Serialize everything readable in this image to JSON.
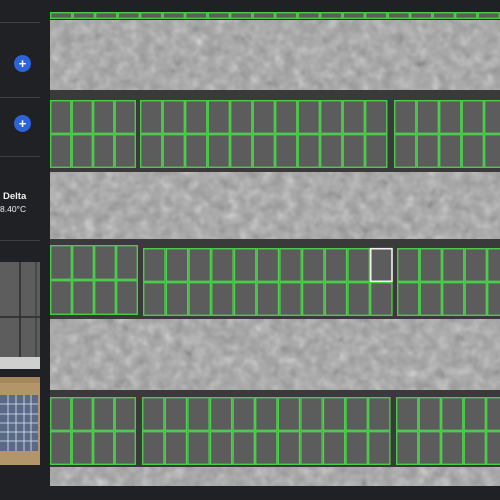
{
  "sidebar": {
    "delta": {
      "label": "Delta",
      "value": "8.40°C"
    },
    "thumbnails": {
      "thermal": "thermal-thumbnail",
      "rgb": "rgb-thumbnail"
    }
  },
  "icons": {
    "add": "plus-circle-icon"
  },
  "colors": {
    "accent": "#2d63d9",
    "panel_outline": "#4cd34c",
    "selected_outline": "#f2f2f2",
    "background": "#1f2124"
  }
}
